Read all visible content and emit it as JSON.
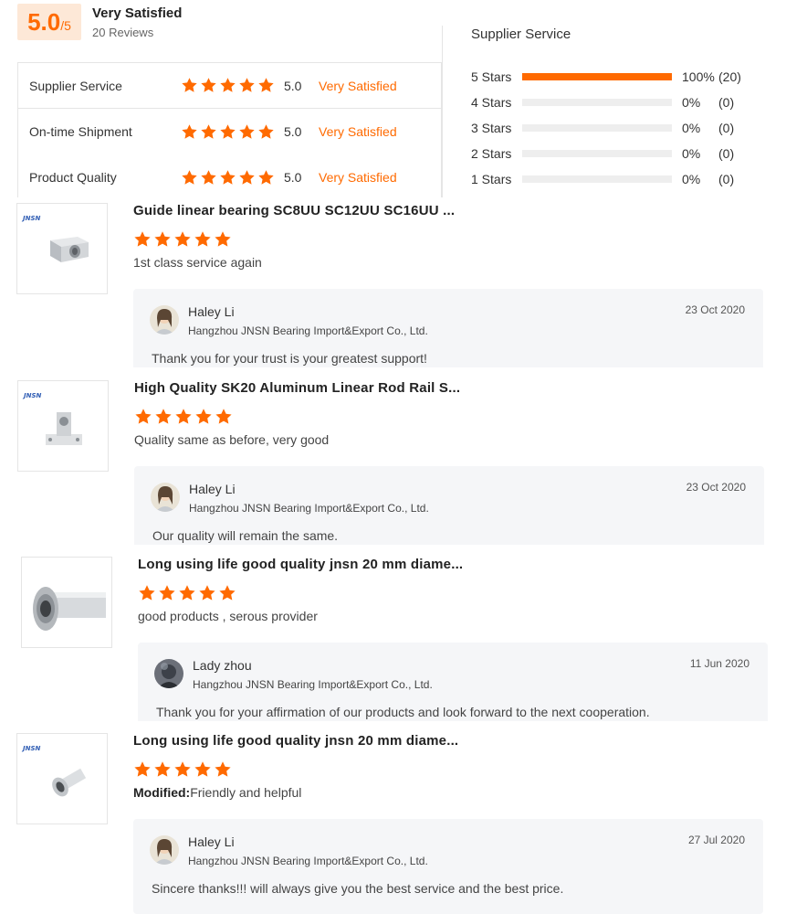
{
  "summary": {
    "score": "5.0",
    "score_den": "/5",
    "label": "Very Satisfied",
    "reviews_count": "20 Reviews"
  },
  "ratings": [
    {
      "label": "Supplier Service",
      "score": "5.0",
      "status": "Very Satisfied",
      "stars": 5
    },
    {
      "label": "On-time Shipment",
      "score": "5.0",
      "status": "Very Satisfied",
      "stars": 5
    },
    {
      "label": "Product Quality",
      "score": "5.0",
      "status": "Very Satisfied",
      "stars": 5
    }
  ],
  "distribution": {
    "title": "Supplier Service",
    "rows": [
      {
        "label": "5  Stars",
        "fraction": 1.0,
        "percent": "100%",
        "count": "(20)"
      },
      {
        "label": "4  Stars",
        "fraction": 0.0,
        "percent": "0%",
        "count": "(0)"
      },
      {
        "label": "3  Stars",
        "fraction": 0.0,
        "percent": "0%",
        "count": "(0)"
      },
      {
        "label": "2  Stars",
        "fraction": 0.0,
        "percent": "0%",
        "count": "(0)"
      },
      {
        "label": "1  Stars",
        "fraction": 0.0,
        "percent": "0%",
        "count": "(0)"
      }
    ]
  },
  "colors": {
    "accent": "#ff6a00",
    "reply_bg": "#f5f6f8"
  },
  "reviews": [
    {
      "product_title": "Guide linear bearing SC8UU SC12UU SC16UU ...",
      "stars": 5,
      "text_prefix": "",
      "text": "1st class service again",
      "reply": {
        "name": "Haley Li",
        "company": "Hangzhou JNSN Bearing Import&Export Co., Ltd.",
        "date": "23 Oct 2020",
        "text": "Thank you for your trust is your greatest support!"
      }
    },
    {
      "product_title": "High Quality SK20 Aluminum Linear Rod Rail S...",
      "stars": 5,
      "text_prefix": "",
      "text": "Quality same as before, very good",
      "reply": {
        "name": "Haley Li",
        "company": "Hangzhou JNSN Bearing Import&Export Co., Ltd.",
        "date": "23 Oct 2020",
        "text": "Our quality will remain the same."
      }
    },
    {
      "product_title": "Long using life good quality jnsn 20 mm diame...",
      "stars": 5,
      "text_prefix": "",
      "text": "good products , serous provider",
      "reply": {
        "name": "Lady zhou",
        "company": "Hangzhou JNSN Bearing Import&Export Co., Ltd.",
        "date": "11 Jun 2020",
        "text": "Thank you for your affirmation of our products and look forward to the next cooperation."
      }
    },
    {
      "product_title": "Long using life good quality jnsn 20 mm diame...",
      "stars": 5,
      "text_prefix": "Modified:",
      "text": "Friendly and helpful",
      "reply": {
        "name": "Haley Li",
        "company": "Hangzhou JNSN Bearing Import&Export Co., Ltd.",
        "date": "27 Jul 2020",
        "text": "Sincere thanks!!!  will always give you the best service and the best price."
      }
    }
  ],
  "icons": {
    "star": "star-icon",
    "thumb1": "linear-bearing-block-image",
    "thumb2": "rail-support-image",
    "thumb3": "flanged-linear-bearing-image",
    "thumb4": "flanged-bearing-image"
  }
}
